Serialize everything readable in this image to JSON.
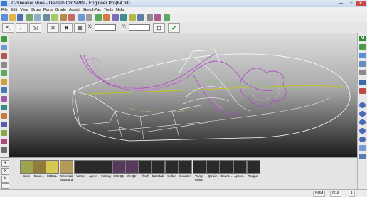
{
  "window": {
    "title": "JC-Sneaker.shoe - Delcam CRISPIN - Engineer Pro(64 bit)",
    "minimize": "—",
    "maximize": "☐",
    "close": "✕"
  },
  "menu": [
    "File",
    "Edit",
    "View",
    "Draw",
    "Parts",
    "Grade",
    "Assist",
    "SketchPac",
    "Tools",
    "Help"
  ],
  "coords": {
    "x_label": "X:",
    "y_label": "Y:",
    "x_value": "",
    "y_value": ""
  },
  "side_letter": "M",
  "components": [
    {
      "label": "Base"
    },
    {
      "label": "Boun..."
    },
    {
      "label": "SHELL"
    },
    {
      "label": "Technical Standard"
    },
    {
      "label": "Vamp"
    },
    {
      "label": "Apron"
    },
    {
      "label": "Facing"
    },
    {
      "label": "Q/S Qtr"
    },
    {
      "label": "I/S Qtr"
    },
    {
      "label": "Flash"
    },
    {
      "label": "Backtab"
    },
    {
      "label": "Collar"
    },
    {
      "label": "Counter"
    },
    {
      "label": "Vamp Lining"
    },
    {
      "label": "Qtr.Lin"
    },
    {
      "label": "Count..."
    },
    {
      "label": "Apron..."
    },
    {
      "label": "Tongue"
    }
  ],
  "status": {
    "mode": "NUM",
    "counter": "0/18",
    "page": "1"
  },
  "colors": {
    "accent_green": "#2d8a2d",
    "curve_purple": "#b04fc4",
    "curve_yellow": "#c8c800",
    "curve_white": "#ffffff"
  }
}
